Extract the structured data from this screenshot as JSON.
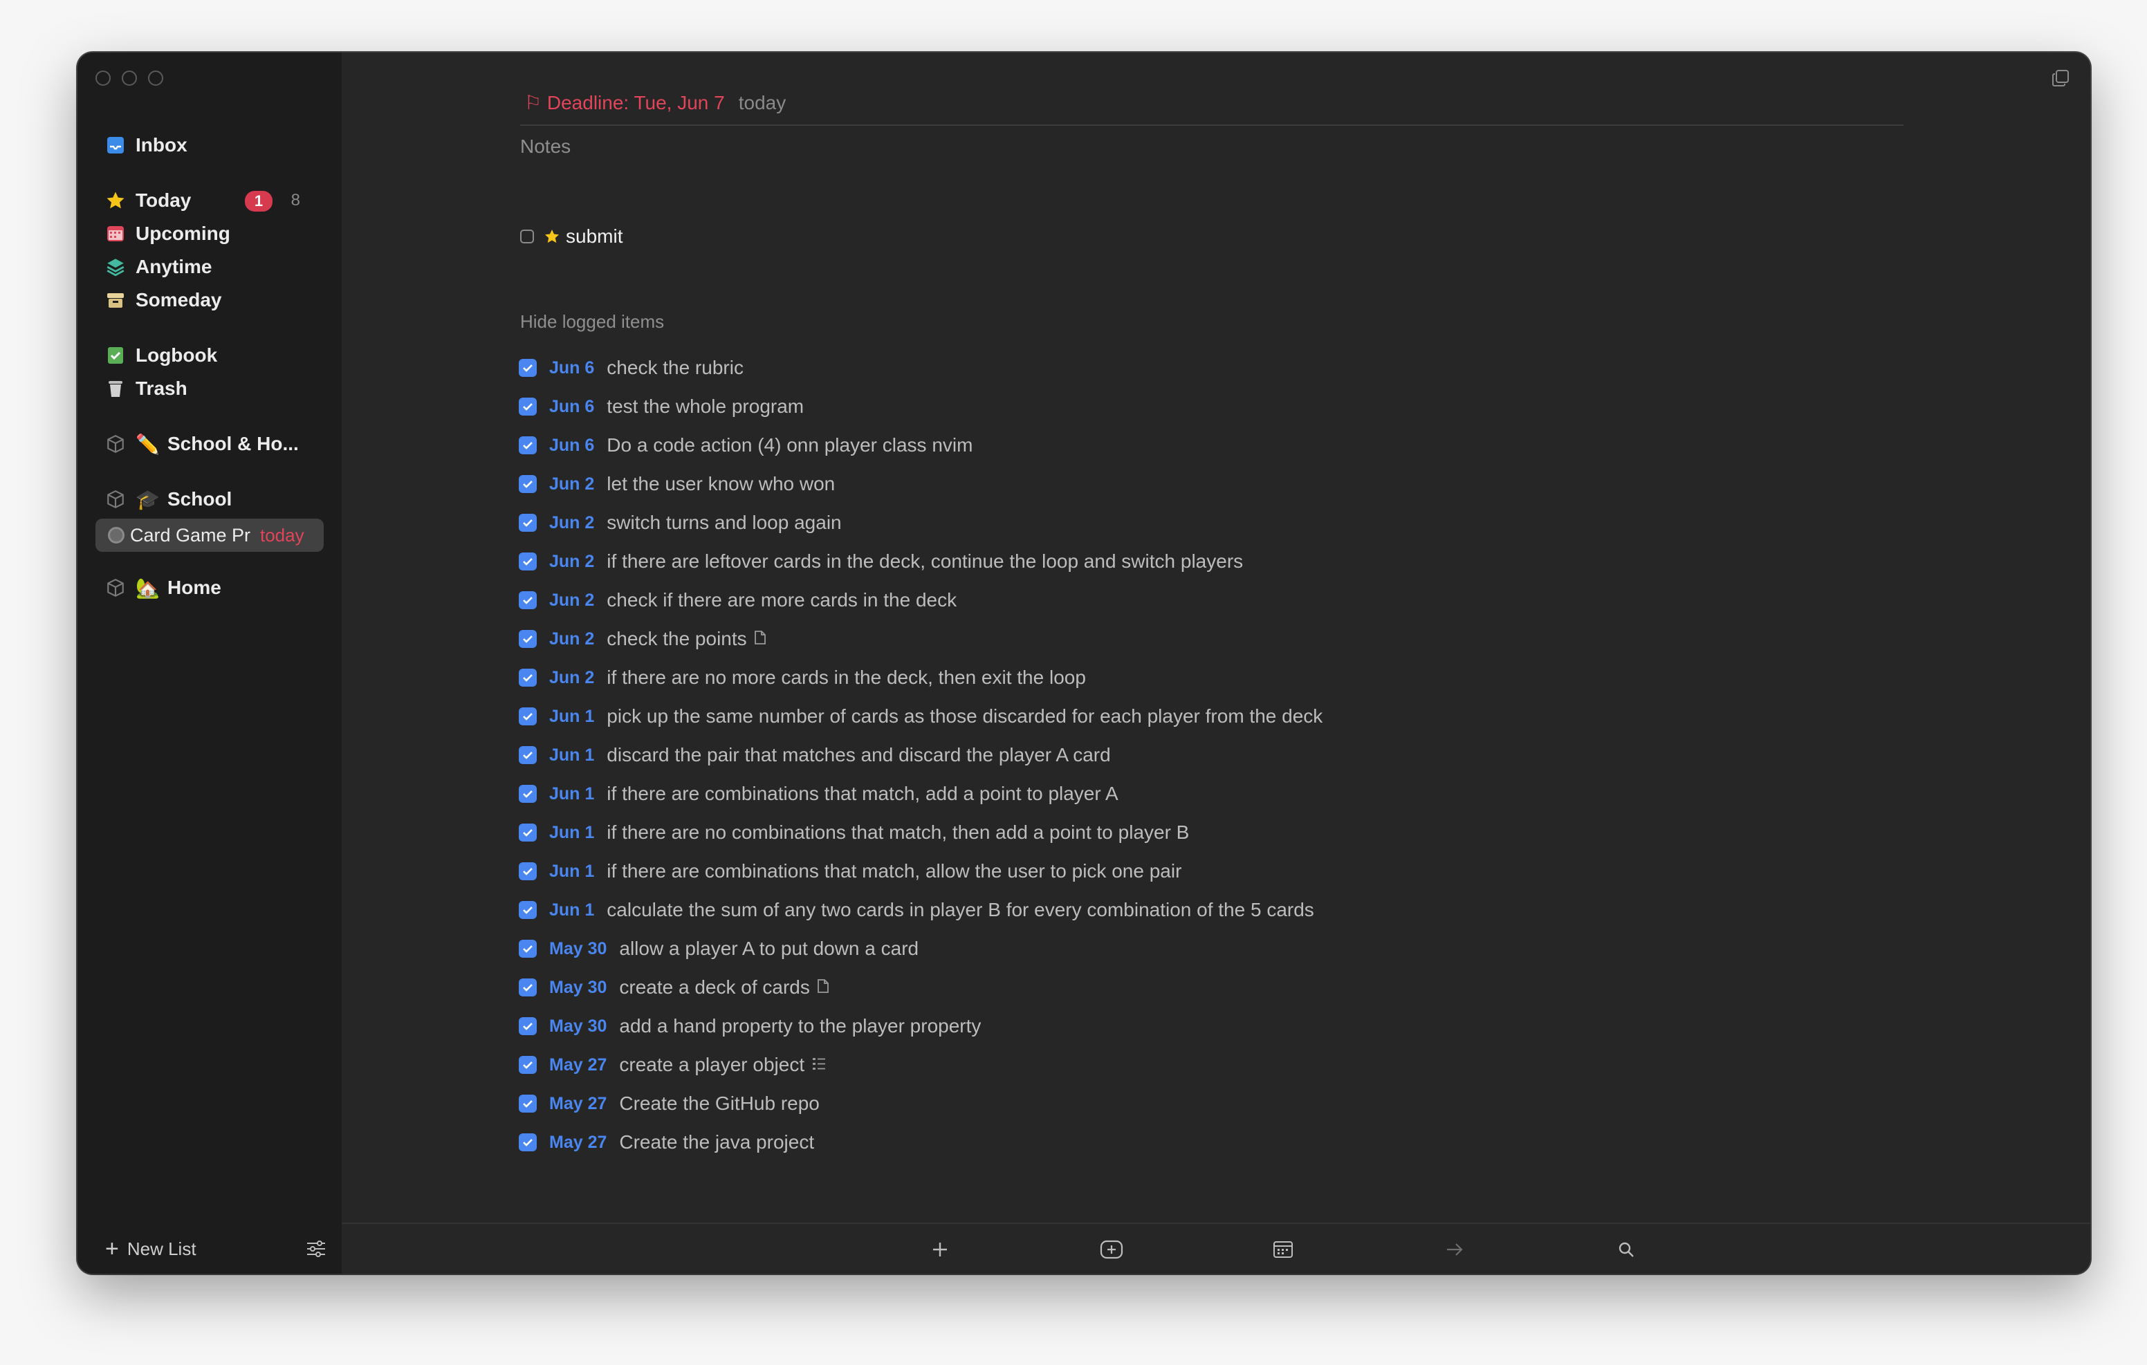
{
  "sidebar": {
    "inbox": "Inbox",
    "today": "Today",
    "today_badge": "1",
    "today_count": "8",
    "upcoming": "Upcoming",
    "anytime": "Anytime",
    "someday": "Someday",
    "logbook": "Logbook",
    "trash": "Trash",
    "area_school_home": "School & Ho...",
    "area_school": "School",
    "project_selected": "Card Game Pr",
    "project_selected_due": "today",
    "area_home": "Home",
    "new_list": "New List"
  },
  "todo": {
    "deadline": "Deadline: Tue, Jun 7",
    "deadline_when": "today",
    "notes_placeholder": "Notes",
    "submit_label": "submit",
    "hide_logged": "Hide logged items"
  },
  "logged_items": [
    {
      "date": "Jun 6",
      "text": "check the rubric",
      "icon": ""
    },
    {
      "date": "Jun 6",
      "text": "test the whole program",
      "icon": ""
    },
    {
      "date": "Jun 6",
      "text": "Do a code action (4) onn player class nvim",
      "icon": ""
    },
    {
      "date": "Jun 2",
      "text": "let the user know who won",
      "icon": ""
    },
    {
      "date": "Jun 2",
      "text": "switch turns and loop again",
      "icon": ""
    },
    {
      "date": "Jun 2",
      "text": "if there are leftover cards in the deck, continue the loop and switch players",
      "icon": ""
    },
    {
      "date": "Jun 2",
      "text": "check if there are more cards in the deck",
      "icon": ""
    },
    {
      "date": "Jun 2",
      "text": "check the points",
      "icon": "note"
    },
    {
      "date": "Jun 2",
      "text": "if there are no more cards in the deck, then exit the loop",
      "icon": ""
    },
    {
      "date": "Jun 1",
      "text": "pick up the same number of cards as those discarded for each player from the deck",
      "icon": ""
    },
    {
      "date": "Jun 1",
      "text": "discard the pair that matches and discard the player A card",
      "icon": ""
    },
    {
      "date": "Jun 1",
      "text": "if there are combinations that match, add a point to player A",
      "icon": ""
    },
    {
      "date": "Jun 1",
      "text": "if there are no combinations that match, then add a point to player B",
      "icon": ""
    },
    {
      "date": "Jun 1",
      "text": "if there are combinations that match, allow the user to pick one pair",
      "icon": ""
    },
    {
      "date": "Jun 1",
      "text": "calculate the sum of any two cards in player B for every combination of the 5 cards",
      "icon": ""
    },
    {
      "date": "May 30",
      "text": "allow a player A to put down a card",
      "icon": ""
    },
    {
      "date": "May 30",
      "text": "create a deck of cards",
      "icon": "note"
    },
    {
      "date": "May 30",
      "text": "add a hand property to the player property",
      "icon": ""
    },
    {
      "date": "May 27",
      "text": "create a player object",
      "icon": "checklist"
    },
    {
      "date": "May 27",
      "text": "Create the GitHub repo",
      "icon": ""
    },
    {
      "date": "May 27",
      "text": "Create the java project",
      "icon": ""
    }
  ],
  "colors": {
    "accent_blue": "#4a86f0",
    "deadline_red": "#e0455a",
    "star_yellow": "#f5c518",
    "sidebar_bg": "#1c1c1c",
    "main_bg": "#262626"
  },
  "icons": {
    "inbox": "inbox-icon",
    "today": "star-icon",
    "upcoming": "calendar-icon",
    "anytime": "layers-icon",
    "someday": "archive-box-icon",
    "logbook": "logbook-icon",
    "trash": "trash-icon",
    "area": "cube-icon",
    "project": "progress-pie-icon",
    "toolbar": [
      "plus-icon",
      "add-heading-icon",
      "calendar-icon",
      "arrow-right-icon",
      "search-icon"
    ]
  }
}
